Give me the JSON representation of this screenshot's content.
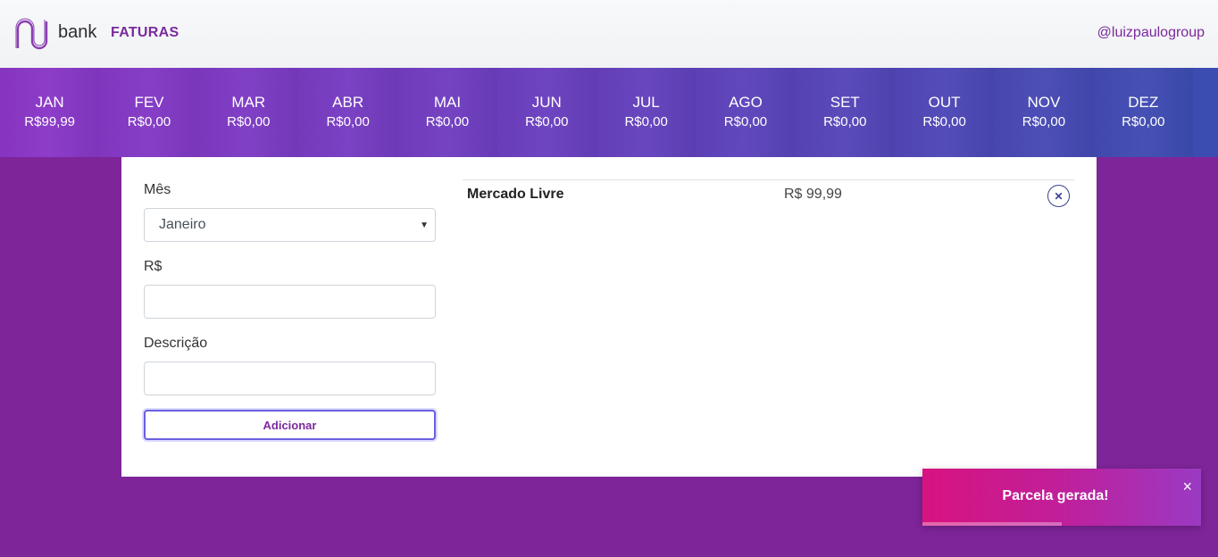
{
  "header": {
    "brand_word": "bank",
    "nav_title": "FATURAS",
    "user": "@luizpaulogroup"
  },
  "months": [
    {
      "name": "JAN",
      "value": "R$99,99"
    },
    {
      "name": "FEV",
      "value": "R$0,00"
    },
    {
      "name": "MAR",
      "value": "R$0,00"
    },
    {
      "name": "ABR",
      "value": "R$0,00"
    },
    {
      "name": "MAI",
      "value": "R$0,00"
    },
    {
      "name": "JUN",
      "value": "R$0,00"
    },
    {
      "name": "JUL",
      "value": "R$0,00"
    },
    {
      "name": "AGO",
      "value": "R$0,00"
    },
    {
      "name": "SET",
      "value": "R$0,00"
    },
    {
      "name": "OUT",
      "value": "R$0,00"
    },
    {
      "name": "NOV",
      "value": "R$0,00"
    },
    {
      "name": "DEZ",
      "value": "R$0,00"
    }
  ],
  "form": {
    "month_label": "Mês",
    "month_selected": "Janeiro",
    "amount_label": "R$",
    "amount_value": "",
    "description_label": "Descrição",
    "description_value": "",
    "add_button": "Adicionar"
  },
  "entries": [
    {
      "description": "Mercado Livre",
      "value": "R$ 99,99",
      "remove_icon": "close-icon"
    }
  ],
  "toast": {
    "message": "Parcela gerada!",
    "close": "×",
    "progress": 0.5
  },
  "colors": {
    "brand_purple": "#7e2599",
    "accent": "#7a2a9c"
  }
}
